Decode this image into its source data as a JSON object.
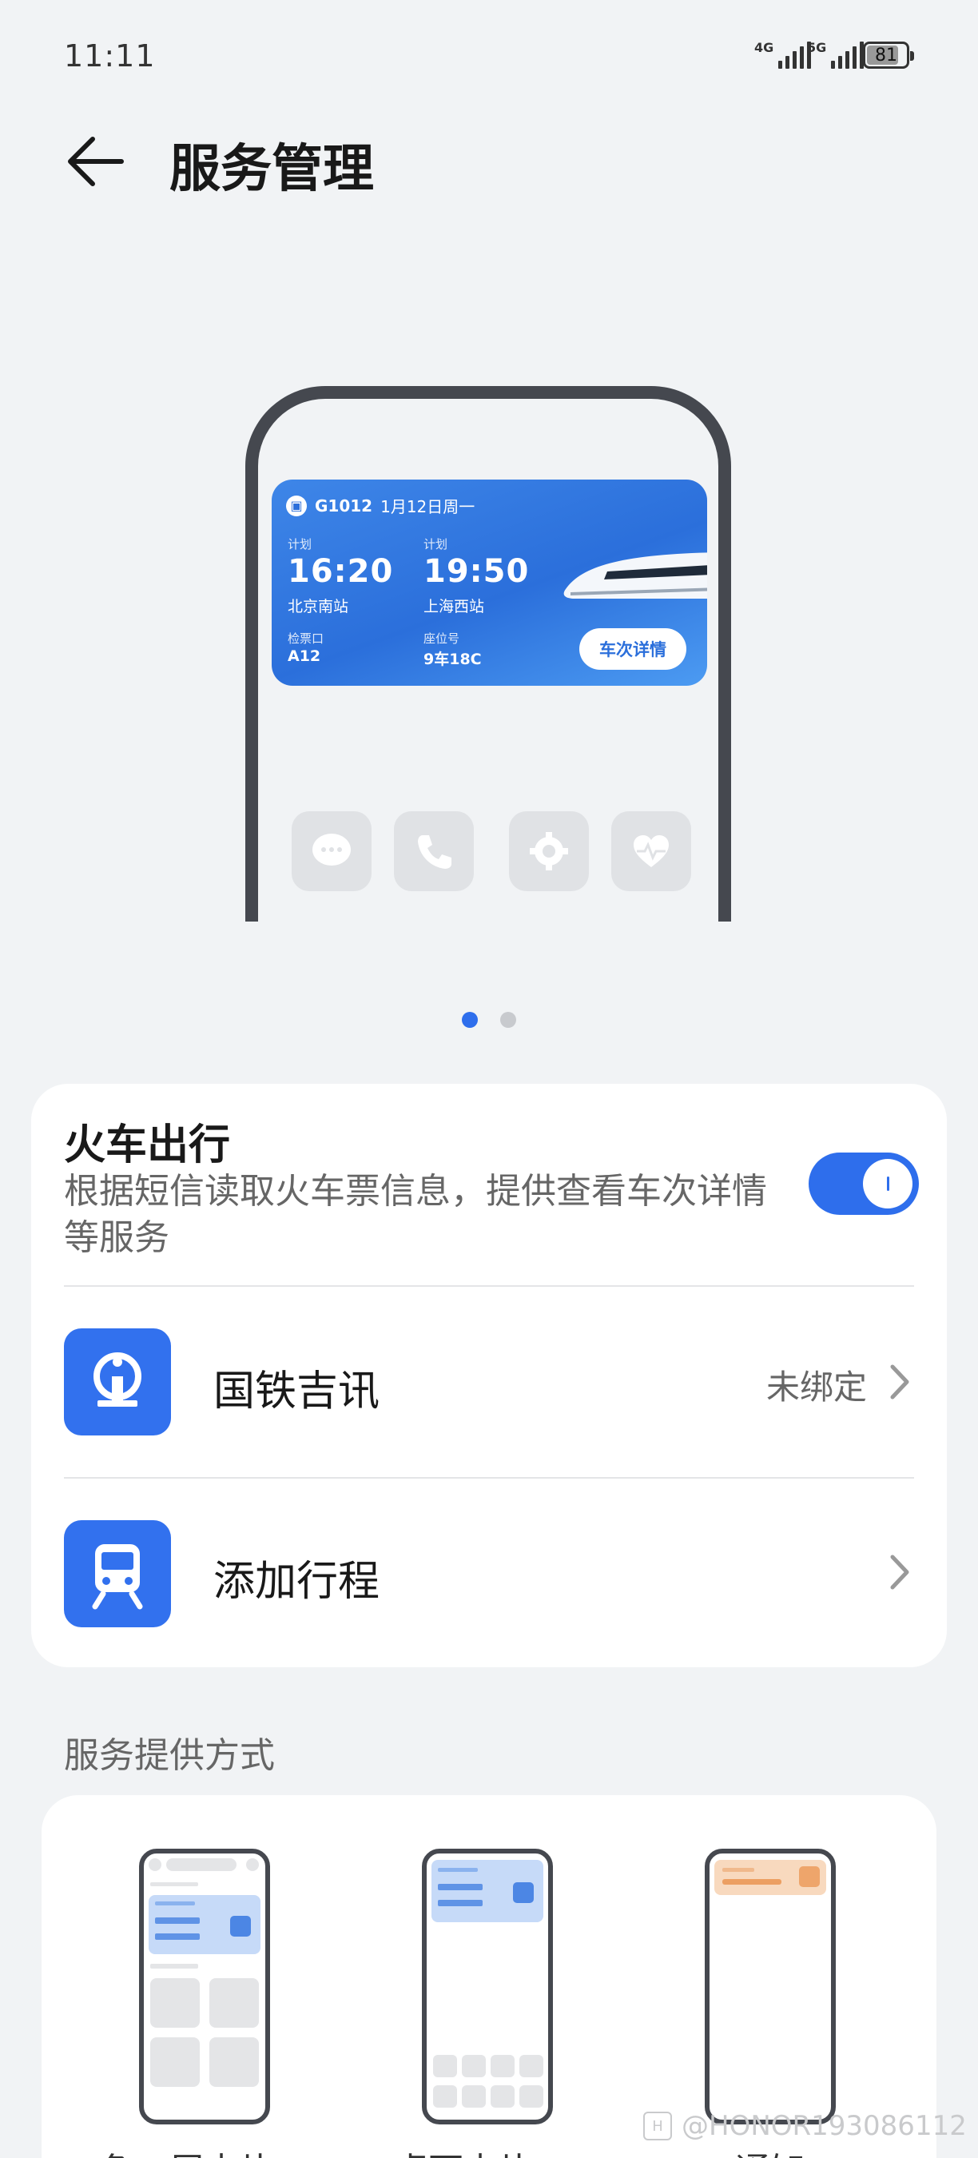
{
  "status_bar": {
    "time": "11:11",
    "network1": "4G",
    "network2": "5G",
    "battery": "81",
    "battery_level": 0.81
  },
  "header": {
    "title": "服务管理",
    "back_icon": "arrow-left-icon"
  },
  "preview": {
    "train_number": "G1012",
    "date": "1月12日周一",
    "dep_label": "计划",
    "dep_time": "16:20",
    "dep_station": "北京南站",
    "arr_label": "计划",
    "arr_time": "19:50",
    "arr_station": "上海西站",
    "gate_label": "检票口",
    "gate": "A12",
    "seat_label": "座位号",
    "seat": "9车18C",
    "detail_button": "车次详情",
    "page_count": 2,
    "active_page": 1
  },
  "feature": {
    "title": "火车出行",
    "description": "根据短信读取火车票信息，提供查看车次详情等服务",
    "enabled": true,
    "accent": "#2E6EEC"
  },
  "rows": [
    {
      "label": "国铁吉讯",
      "status": "未绑定",
      "icon": "railway-logo-icon"
    },
    {
      "label": "添加行程",
      "status": "",
      "icon": "train-icon"
    }
  ],
  "section": {
    "title": "服务提供方式"
  },
  "modes_cut_labels": [
    "负一屏卡片",
    "桌面卡片",
    "通知"
  ],
  "watermark": "@HONOR193086112"
}
